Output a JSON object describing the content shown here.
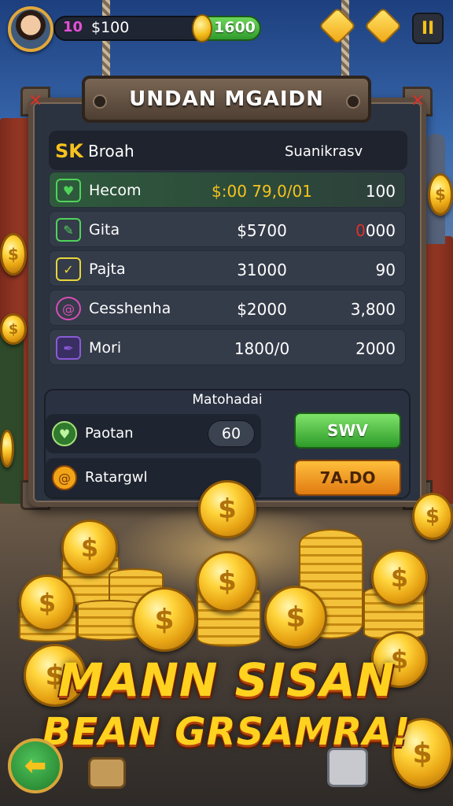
{
  "topbar": {
    "level": "10",
    "cash": "$100",
    "coins": "1600",
    "pause_symbol": "II"
  },
  "panel": {
    "title": "UNDAN MGAIDN",
    "close_symbol": "✕"
  },
  "table": {
    "header": {
      "icon_text": "SK",
      "name": "Broah",
      "stat": "Suanikrasv"
    },
    "rows": [
      {
        "name": "Hecom",
        "price": "$:00 79,0/01",
        "value": "100",
        "icon": "heart-icon",
        "icon_color": "#4fd35a",
        "active": true,
        "price_color": "#f6c21d",
        "value_color": "#ffffff"
      },
      {
        "name": "Gita",
        "price": "$5700",
        "value": "0000",
        "icon": "leaf-icon",
        "icon_color": "#4fd35a",
        "active": false,
        "price_color": "#ffffff",
        "value_color": "#ffffff",
        "value_prefix": "0",
        "value_prefix_color": "#e0322a"
      },
      {
        "name": "Pajta",
        "price": "31000",
        "value": "90",
        "icon": "check-icon",
        "icon_color": "#e7d53a",
        "active": false,
        "price_color": "#ffffff",
        "value_color": "#ffffff"
      },
      {
        "name": "Cesshenha",
        "price": "$2000",
        "value": "3,800",
        "icon": "swirl-icon",
        "icon_color": "#d64fb6",
        "active": false,
        "price_color": "#ffffff",
        "value_color": "#ffffff"
      },
      {
        "name": "Mori",
        "price": "1800/0",
        "value": "2000",
        "icon": "quill-icon",
        "icon_color": "#8a5ad8",
        "active": false,
        "price_color": "#ffffff",
        "value_color": "#ffffff"
      }
    ]
  },
  "summary": {
    "title": "Matohadai",
    "rows": [
      {
        "label": "Paotan",
        "badge": "60",
        "icon": "heart-icon"
      },
      {
        "label": "Ratargwl",
        "badge": "",
        "icon": "swirl-icon"
      }
    ],
    "buttons": {
      "primary": "SWV",
      "secondary": "7A.DO"
    }
  },
  "banner": {
    "line1": "MANN SISAN",
    "line2": "BEAN GRSAMRA!"
  },
  "colors": {
    "gold": "#ffd21f",
    "panel": "#2c3340",
    "green_button": "#2e9b2a",
    "orange_button": "#e07a12",
    "level_pink": "#e64fd6"
  },
  "coin_symbol": "$"
}
